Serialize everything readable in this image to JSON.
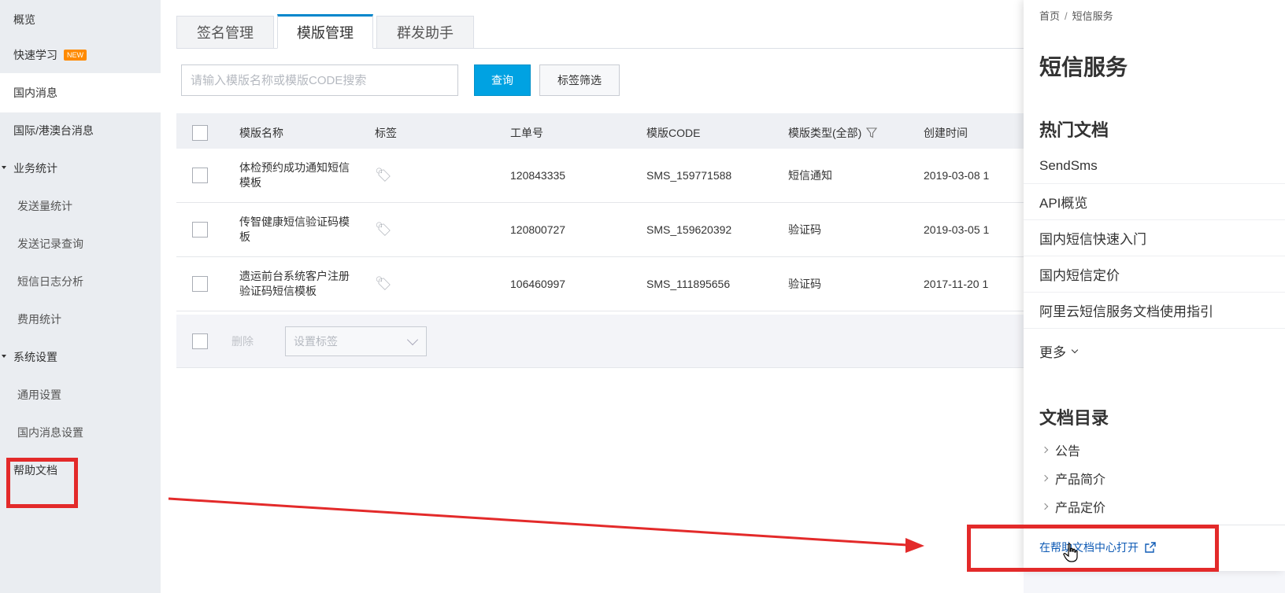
{
  "sidebar": {
    "items": [
      {
        "label": "概览"
      },
      {
        "label": "快速学习",
        "badge": "NEW"
      },
      {
        "label": "国内消息"
      },
      {
        "label": "国际/港澳台消息"
      },
      {
        "label": "业务统计"
      },
      {
        "label": "发送量统计"
      },
      {
        "label": "发送记录查询"
      },
      {
        "label": "短信日志分析"
      },
      {
        "label": "费用统计"
      },
      {
        "label": "系统设置"
      },
      {
        "label": "通用设置"
      },
      {
        "label": "国内消息设置"
      },
      {
        "label": "帮助文档"
      }
    ]
  },
  "tabs": [
    {
      "label": "签名管理"
    },
    {
      "label": "模版管理"
    },
    {
      "label": "群发助手"
    }
  ],
  "search": {
    "placeholder": "请输入模版名称或模版CODE搜索",
    "query_label": "查询",
    "filter_label": "标签筛选"
  },
  "table": {
    "headers": {
      "name": "模版名称",
      "tag": "标签",
      "order": "工单号",
      "code": "模版CODE",
      "type": "模版类型(全部)",
      "created": "创建时间"
    },
    "rows": [
      {
        "name": "体检预约成功通知短信模板",
        "order": "120843335",
        "code": "SMS_159771588",
        "type": "短信通知",
        "created": "2019-03-08 1"
      },
      {
        "name": "传智健康短信验证码模板",
        "order": "120800727",
        "code": "SMS_159620392",
        "type": "验证码",
        "created": "2019-03-05 1"
      },
      {
        "name": "遗运前台系统客户注册验证码短信模板",
        "order": "106460997",
        "code": "SMS_111895656",
        "type": "验证码",
        "created": "2017-11-20 1"
      }
    ],
    "footer": {
      "delete_label": "删除",
      "set_tag_placeholder": "设置标签"
    }
  },
  "panel": {
    "breadcrumb": [
      "首页",
      "/",
      "短信服务"
    ],
    "title": "短信服务",
    "hot_docs_title": "热门文档",
    "hot_docs": [
      "SendSms",
      "API概览",
      "国内短信快速入门",
      "国内短信定价",
      "阿里云短信服务文档使用指引"
    ],
    "more_label": "更多",
    "catalog_title": "文档目录",
    "catalog": [
      "公告",
      "产品简介",
      "产品定价"
    ],
    "open_help_label": "在帮助文档中心打开"
  },
  "colors": {
    "accent": "#00a2e2",
    "annotation_red": "#e32a2a",
    "link": "#0f5bb5",
    "badge": "#ff8a00"
  }
}
